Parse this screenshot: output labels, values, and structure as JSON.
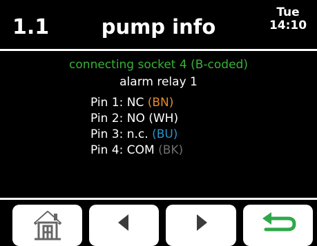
{
  "header": {
    "menu_id": "1.1",
    "title": "pump info",
    "day": "Tue",
    "time": "14:10"
  },
  "content": {
    "connection": "connecting socket 4 (B-coded)",
    "relay": "alarm relay 1",
    "pins": [
      {
        "label": "Pin 1: NC",
        "wire": "(BN)",
        "wire_color": "#e6892b"
      },
      {
        "label": "Pin 2: NO (WH)",
        "wire": "",
        "wire_color": "#ffffff"
      },
      {
        "label": "Pin 3: n.c.",
        "wire": "(BU)",
        "wire_color": "#2b93c8"
      },
      {
        "label": "Pin 4: COM",
        "wire": "(BK)",
        "wire_color": "#6f6f6f"
      }
    ]
  },
  "footer": {
    "buttons": [
      {
        "icon": "home-icon"
      },
      {
        "icon": "arrow-left-icon"
      },
      {
        "icon": "arrow-right-icon"
      },
      {
        "icon": "return-icon",
        "icon_color": "#2fa84a"
      }
    ]
  },
  "colors": {
    "background": "#000000",
    "text": "#ffffff",
    "connection_text": "#37b237"
  }
}
